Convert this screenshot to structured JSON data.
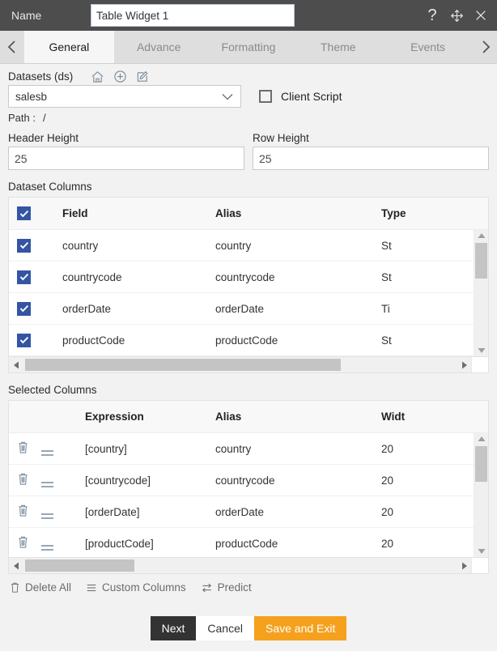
{
  "titlebar": {
    "name_label": "Name",
    "name_value": "Table Widget 1",
    "help_icon": "question-mark-icon",
    "move_icon": "move-icon",
    "close_icon": "close-icon"
  },
  "tabs": {
    "prev_label": "‹",
    "next_label": "›",
    "items": [
      {
        "label": "General",
        "active": true
      },
      {
        "label": "Advance",
        "active": false
      },
      {
        "label": "Formatting",
        "active": false
      },
      {
        "label": "Theme",
        "active": false
      },
      {
        "label": "Events",
        "active": false
      }
    ]
  },
  "datasets": {
    "label": "Datasets (ds)",
    "icons": [
      "home-icon",
      "add-circle-icon",
      "edit-icon"
    ],
    "selected": "salesb",
    "client_script_label": "Client Script",
    "client_script_checked": false,
    "path_label": "Path :",
    "path_value": "/"
  },
  "heights": {
    "header_height_label": "Header Height",
    "header_height_value": "25",
    "row_height_label": "Row Height",
    "row_height_value": "25"
  },
  "dataset_columns": {
    "title": "Dataset Columns",
    "headers": {
      "select_all_checked": true,
      "field": "Field",
      "alias": "Alias",
      "type": "Type"
    },
    "rows": [
      {
        "checked": true,
        "field": "country",
        "alias": "country",
        "type": "St"
      },
      {
        "checked": true,
        "field": "countrycode",
        "alias": "countrycode",
        "type": "St"
      },
      {
        "checked": true,
        "field": "orderDate",
        "alias": "orderDate",
        "type": "Ti"
      },
      {
        "checked": true,
        "field": "productCode",
        "alias": "productCode",
        "type": "St"
      }
    ]
  },
  "selected_columns": {
    "title": "Selected Columns",
    "headers": {
      "expression": "Expression",
      "alias": "Alias",
      "width": "Widt"
    },
    "rows": [
      {
        "delete_icon": "trash-icon",
        "drag_icon": "drag-handle-icon",
        "expression": "[country]",
        "alias": "country",
        "width": "20"
      },
      {
        "delete_icon": "trash-icon",
        "drag_icon": "drag-handle-icon",
        "expression": "[countrycode]",
        "alias": "countrycode",
        "width": "20"
      },
      {
        "delete_icon": "trash-icon",
        "drag_icon": "drag-handle-icon",
        "expression": "[orderDate]",
        "alias": "orderDate",
        "width": "20"
      },
      {
        "delete_icon": "trash-icon",
        "drag_icon": "drag-handle-icon",
        "expression": "[productCode]",
        "alias": "productCode",
        "width": "20"
      }
    ]
  },
  "toolbar": {
    "delete_all": "Delete All",
    "custom_columns": "Custom Columns",
    "predict": "Predict"
  },
  "footer": {
    "next": "Next",
    "cancel": "Cancel",
    "save_and_exit": "Save and Exit"
  },
  "colors": {
    "titlebar_bg": "#4d4d4d",
    "tabbar_bg": "#dedede",
    "active_tab_bg": "#f6f6f6",
    "checkbox_blue": "#3455a4",
    "save_orange": "#f5a11e",
    "next_dark": "#333333",
    "page_bg": "#f2f2f2"
  }
}
